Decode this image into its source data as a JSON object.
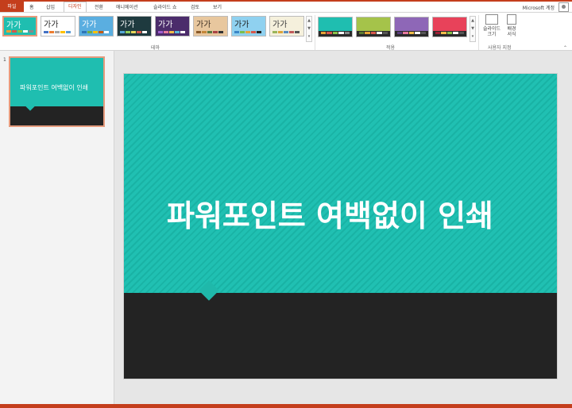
{
  "tabs": {
    "file": "파일",
    "home": "홈",
    "insert": "삽입",
    "design": "디자인",
    "transitions": "전환",
    "animations": "애니메이션",
    "slideshow": "슬라이드 쇼",
    "review": "검토",
    "view": "보기",
    "account": "Microsoft 계정"
  },
  "ribbon": {
    "themes_group": "테마",
    "variants_group": "적용",
    "customize_group": "사용자 지정",
    "slide_size": "슬라이드 크기",
    "format_bg": "배경 서식",
    "themes": [
      {
        "label": "가가",
        "bg": "#1fbeb0",
        "fg": "#ffffff",
        "bars": [
          "#e7a236",
          "#d6584b",
          "#8ac149",
          "#ffffff",
          "#888888"
        ]
      },
      {
        "label": "가가",
        "bg": "#ffffff",
        "fg": "#222222",
        "bars": [
          "#4472c4",
          "#ed7d31",
          "#a5a5a5",
          "#ffc000",
          "#5b9bd5"
        ]
      },
      {
        "label": "가가",
        "bg": "#5aaee0",
        "fg": "#ffffff",
        "bars": [
          "#2e75b6",
          "#70ad47",
          "#ffc000",
          "#c55a11",
          "#ffffff"
        ]
      },
      {
        "label": "가가",
        "bg": "#1e3a3f",
        "fg": "#ffffff",
        "bars": [
          "#56a8d8",
          "#8fcf5e",
          "#e6d65a",
          "#d6584b",
          "#ffffff"
        ]
      },
      {
        "label": "가가",
        "bg": "#4b2c6b",
        "fg": "#ffffff",
        "bars": [
          "#a05fd0",
          "#e6799e",
          "#f1bc49",
          "#5ab7d8",
          "#ffffff"
        ]
      },
      {
        "label": "가가",
        "bg": "#e8c79e",
        "fg": "#3a2c20",
        "bars": [
          "#8a5a2a",
          "#c5873a",
          "#5b7a40",
          "#a44",
          "#333333"
        ]
      },
      {
        "label": "가가",
        "bg": "#8fd1f0",
        "fg": "#1a1a1a",
        "bars": [
          "#3b86c7",
          "#7cbf4d",
          "#e9a53a",
          "#d6584b",
          "#222222"
        ]
      },
      {
        "label": "가가",
        "bg": "#f5f0dc",
        "fg": "#3a3a3a",
        "bars": [
          "#9bb55a",
          "#dba43a",
          "#5a8cc0",
          "#c05a5a",
          "#555555"
        ]
      }
    ],
    "variants": [
      {
        "bg": "#1fbeb0",
        "bars": [
          "#e7a236",
          "#d6584b",
          "#8ac149",
          "#ffffff",
          "#888888"
        ]
      },
      {
        "bg": "#a5c34a",
        "bars": [
          "#5b7a30",
          "#e7a236",
          "#d6584b",
          "#ffffff",
          "#555555"
        ]
      },
      {
        "bg": "#8e67b7",
        "bars": [
          "#5a3d7d",
          "#e6799e",
          "#f1bc49",
          "#ffffff",
          "#555555"
        ]
      },
      {
        "bg": "#e8425a",
        "bars": [
          "#9c2035",
          "#f1bc49",
          "#8ac149",
          "#ffffff",
          "#555555"
        ]
      }
    ]
  },
  "thumbnails": {
    "number": "1",
    "title": "파워포인트 여백없이 인쇄"
  },
  "slide": {
    "title": "파워포인트 여백없이 인쇄"
  }
}
